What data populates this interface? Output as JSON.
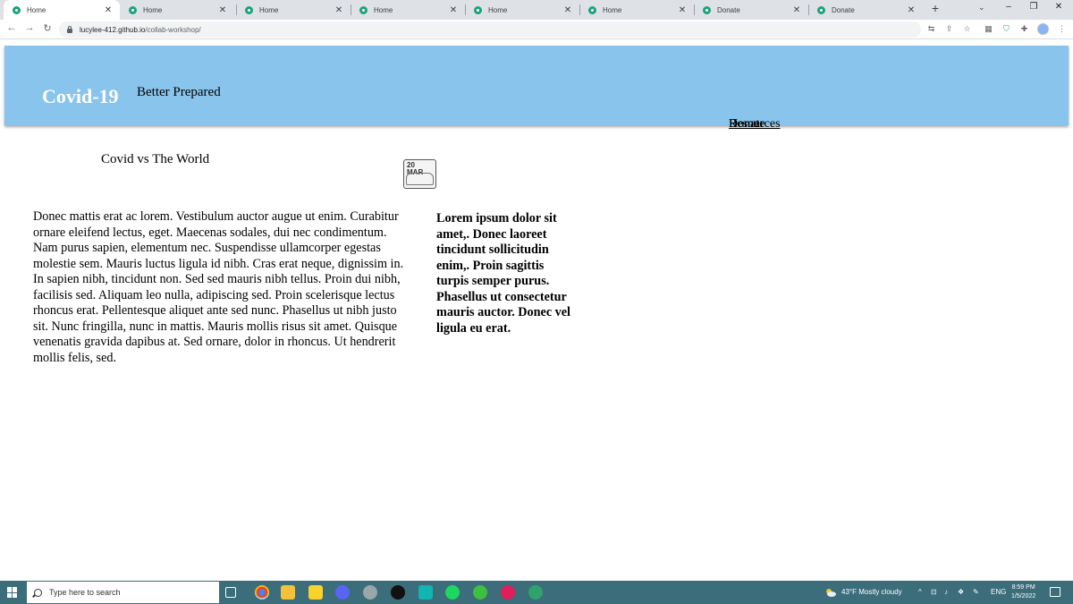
{
  "browser": {
    "tabs": [
      {
        "title": "Home",
        "active": true
      },
      {
        "title": "Home",
        "active": false
      },
      {
        "title": "Home",
        "active": false
      },
      {
        "title": "Home",
        "active": false
      },
      {
        "title": "Home",
        "active": false
      },
      {
        "title": "Home",
        "active": false
      },
      {
        "title": "Donate",
        "active": false
      },
      {
        "title": "Donate",
        "active": false
      }
    ],
    "close_glyph": "✕",
    "new_tab_glyph": "+",
    "url_host": "lucylee-412.github.io",
    "url_path": "/collab-workshop/"
  },
  "site": {
    "brand": "Covid-19",
    "tagline": "Better Prepared",
    "nav_links": [
      "Home",
      "Donate",
      "Resources"
    ],
    "subheading": "Covid vs The World",
    "logo_text": "20\nMAR",
    "body_paragraph": "Donec mattis erat ac lorem. Vestibulum auctor augue ut enim. Curabitur ornare eleifend lectus, eget. Maecenas sodales, dui nec condimentum. Nam purus sapien, elementum nec. Suspendisse ullamcorper egestas molestie sem. Mauris luctus ligula id nibh. Cras erat neque, dignissim in. In sapien nibh, tincidunt non. Sed sed mauris nibh tellus. Proin dui nibh, facilisis sed. Aliquam leo nulla, adipiscing sed. Proin scelerisque lectus rhoncus erat. Pellentesque aliquet ante sed nunc. Phasellus ut nibh justo sit. Nunc fringilla, nunc in mattis. Mauris mollis risus sit amet. Quisque venenatis gravida dapibus at. Sed ornare, dolor in rhoncus. Ut hendrerit mollis felis, sed.",
    "aside_paragraph": "Lorem ipsum dolor sit amet,. Donec laoreet tincidunt sollicitudin enim,. Proin sagittis turpis semper purus. Phasellus ut consectetur mauris auctor. Donec vel ligula eu erat.",
    "banner_color": "#89c4ed"
  },
  "taskbar": {
    "search_placeholder": "Type here to search",
    "weather": "43°F  Mostly cloudy",
    "language": "ENG",
    "time": "8:59 PM",
    "date": "1/5/2022"
  }
}
